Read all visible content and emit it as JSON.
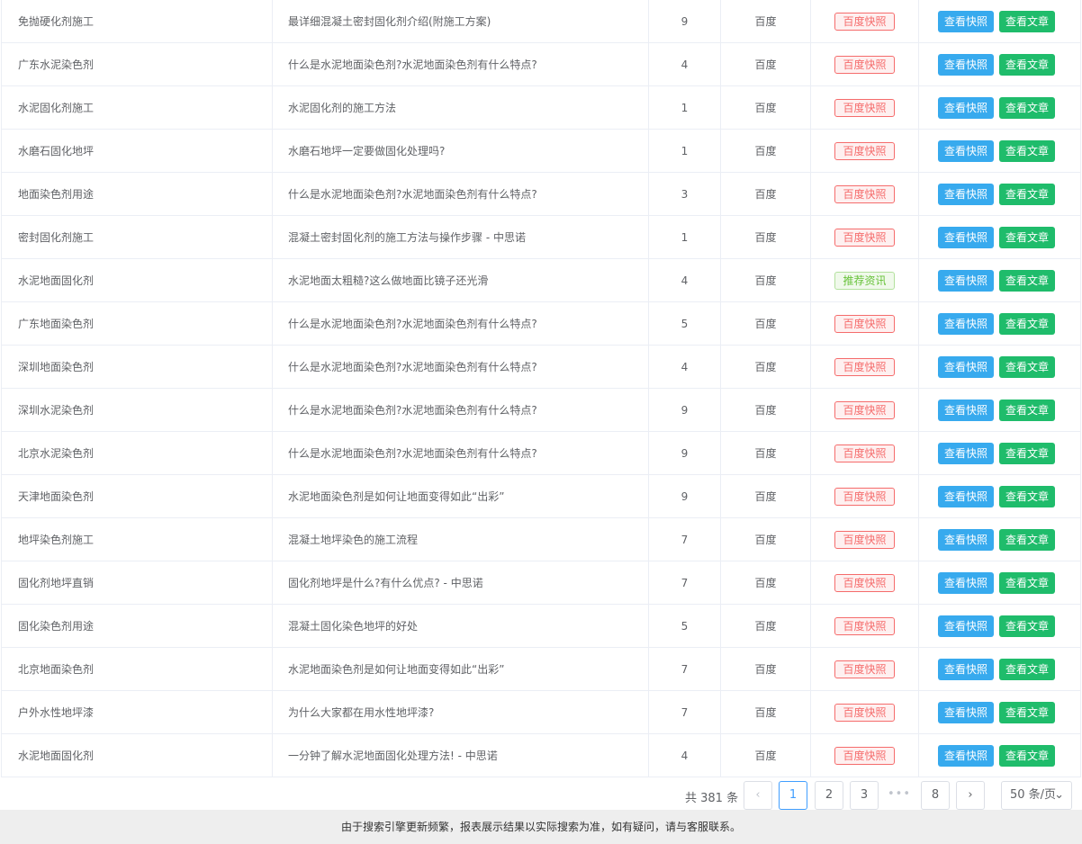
{
  "rows": [
    {
      "keyword": "免抛硬化剂施工",
      "title": "最详细混凝土密封固化剂介绍(附施工方案)",
      "rank": "9",
      "engine": "百度",
      "source": "百度快照",
      "source_type": "red"
    },
    {
      "keyword": "广东水泥染色剂",
      "title": "什么是水泥地面染色剂?水泥地面染色剂有什么特点?",
      "rank": "4",
      "engine": "百度",
      "source": "百度快照",
      "source_type": "red"
    },
    {
      "keyword": "水泥固化剂施工",
      "title": "水泥固化剂的施工方法",
      "rank": "1",
      "engine": "百度",
      "source": "百度快照",
      "source_type": "red"
    },
    {
      "keyword": "水磨石固化地坪",
      "title": "水磨石地坪一定要做固化处理吗?",
      "rank": "1",
      "engine": "百度",
      "source": "百度快照",
      "source_type": "red"
    },
    {
      "keyword": "地面染色剂用途",
      "title": "什么是水泥地面染色剂?水泥地面染色剂有什么特点?",
      "rank": "3",
      "engine": "百度",
      "source": "百度快照",
      "source_type": "red"
    },
    {
      "keyword": "密封固化剂施工",
      "title": "混凝土密封固化剂的施工方法与操作步骤 - 中思诺",
      "rank": "1",
      "engine": "百度",
      "source": "百度快照",
      "source_type": "red"
    },
    {
      "keyword": "水泥地面固化剂",
      "title": "水泥地面太粗糙?这么做地面比镜子还光滑",
      "rank": "4",
      "engine": "百度",
      "source": "推荐资讯",
      "source_type": "green"
    },
    {
      "keyword": "广东地面染色剂",
      "title": "什么是水泥地面染色剂?水泥地面染色剂有什么特点?",
      "rank": "5",
      "engine": "百度",
      "source": "百度快照",
      "source_type": "red"
    },
    {
      "keyword": "深圳地面染色剂",
      "title": "什么是水泥地面染色剂?水泥地面染色剂有什么特点?",
      "rank": "4",
      "engine": "百度",
      "source": "百度快照",
      "source_type": "red"
    },
    {
      "keyword": "深圳水泥染色剂",
      "title": "什么是水泥地面染色剂?水泥地面染色剂有什么特点?",
      "rank": "9",
      "engine": "百度",
      "source": "百度快照",
      "source_type": "red"
    },
    {
      "keyword": "北京水泥染色剂",
      "title": "什么是水泥地面染色剂?水泥地面染色剂有什么特点?",
      "rank": "9",
      "engine": "百度",
      "source": "百度快照",
      "source_type": "red"
    },
    {
      "keyword": "天津地面染色剂",
      "title": "水泥地面染色剂是如何让地面变得如此“出彩”",
      "rank": "9",
      "engine": "百度",
      "source": "百度快照",
      "source_type": "red"
    },
    {
      "keyword": "地坪染色剂施工",
      "title": "混凝土地坪染色的施工流程",
      "rank": "7",
      "engine": "百度",
      "source": "百度快照",
      "source_type": "red"
    },
    {
      "keyword": "固化剂地坪直销",
      "title": "固化剂地坪是什么?有什么优点? - 中思诺",
      "rank": "7",
      "engine": "百度",
      "source": "百度快照",
      "source_type": "red"
    },
    {
      "keyword": "固化染色剂用途",
      "title": "混凝土固化染色地坪的好处",
      "rank": "5",
      "engine": "百度",
      "source": "百度快照",
      "source_type": "red"
    },
    {
      "keyword": "北京地面染色剂",
      "title": "水泥地面染色剂是如何让地面变得如此“出彩”",
      "rank": "7",
      "engine": "百度",
      "source": "百度快照",
      "source_type": "red"
    },
    {
      "keyword": "户外水性地坪漆",
      "title": "为什么大家都在用水性地坪漆?",
      "rank": "7",
      "engine": "百度",
      "source": "百度快照",
      "source_type": "red"
    },
    {
      "keyword": "水泥地面固化剂",
      "title": "一分钟了解水泥地面固化处理方法! - 中思诺",
      "rank": "4",
      "engine": "百度",
      "source": "百度快照",
      "source_type": "red"
    }
  ],
  "actions": {
    "snapshot_label": "查看快照",
    "article_label": "查看文章"
  },
  "pagination": {
    "total_text": "共 381 条",
    "prev_icon": "chevron-left-icon",
    "next_icon": "chevron-right-icon",
    "pages": [
      "1",
      "2",
      "3",
      "8"
    ],
    "current": "1",
    "ellipsis": "•••",
    "page_size": "50 条/页"
  },
  "footer": {
    "notice": "由于搜索引擎更新频繁，报表展示结果以实际搜索为准，如有疑问，请与客服联系。"
  },
  "colors": {
    "snapshot_button": "#37aaee",
    "article_button": "#1fbc6b",
    "tag_red": "#f56c6c",
    "tag_green": "#67c23a",
    "active_page": "#409eff"
  }
}
